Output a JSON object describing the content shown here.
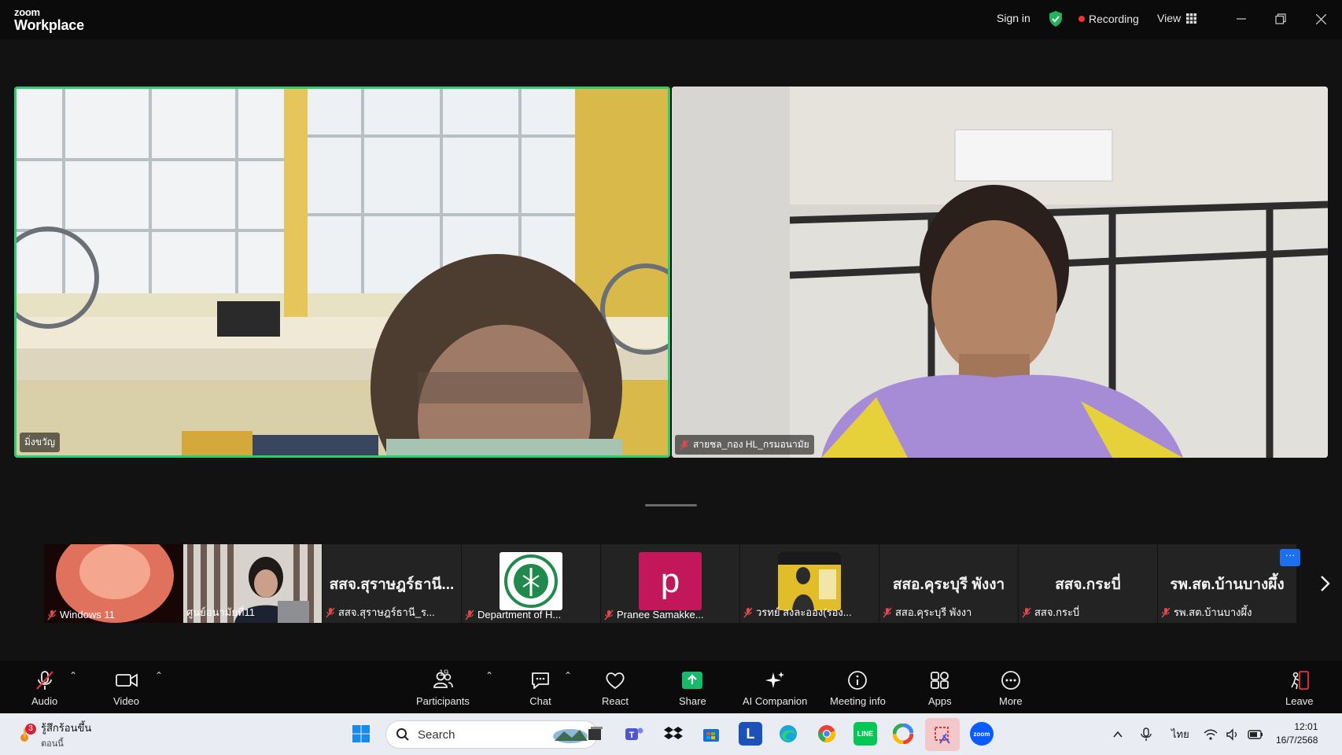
{
  "app": {
    "logo_line1": "zoom",
    "logo_line2": "Workplace"
  },
  "header": {
    "sign_in": "Sign in",
    "recording": "Recording",
    "view": "View"
  },
  "tiles": [
    {
      "name": "มิ่งขวัญ",
      "muted": false,
      "active_speaker": true
    },
    {
      "name": "สายชล_กอง HL_กรมอนามัย",
      "muted": true,
      "active_speaker": false
    }
  ],
  "thumbnails": [
    {
      "label": "Windows 11",
      "big": "",
      "kind": "video-blur"
    },
    {
      "label": "ศูนย์อนามัยที่11",
      "big": "",
      "kind": "video-person"
    },
    {
      "label": "สสจ.สุราษฎร์ธานี_ร...",
      "big": "สสจ.สุราษฎร์ธานี...",
      "kind": "text"
    },
    {
      "label": "Department of H...",
      "big": "",
      "kind": "logo"
    },
    {
      "label": "Pranee Samakke...",
      "big": "p",
      "kind": "letter"
    },
    {
      "label": "วรทย์ สงละออง(รอง...",
      "big": "",
      "kind": "photo"
    },
    {
      "label": "สสอ.คุระบุรี พังงา",
      "big": "สสอ.คุระบุรี พังงา",
      "kind": "text"
    },
    {
      "label": "สสจ.กระบี่",
      "big": "สสจ.กระบี่",
      "kind": "text"
    },
    {
      "label": "รพ.สต.บ้านบางผึ้ง",
      "big": "รพ.สต.บ้านบางผึ้ง",
      "kind": "text"
    }
  ],
  "toolbar": {
    "audio": "Audio",
    "video": "Video",
    "participants": "Participants",
    "participants_count": "19",
    "chat": "Chat",
    "react": "React",
    "share": "Share",
    "ai_companion": "AI Companion",
    "meeting_info": "Meeting info",
    "apps": "Apps",
    "more": "More",
    "leave": "Leave"
  },
  "taskbar": {
    "weather_badge": "3",
    "weather_line1": "รู้สึกร้อนขึ้น",
    "weather_line2": "ตอนนี้",
    "search_placeholder": "Search",
    "language": "ไทย",
    "time": "12:01",
    "date": "16/7/2568"
  },
  "colors": {
    "accent_green": "#2ecc71",
    "share_green": "#18b96b",
    "recording_red": "#e33333",
    "leave_red": "#e0343a"
  }
}
